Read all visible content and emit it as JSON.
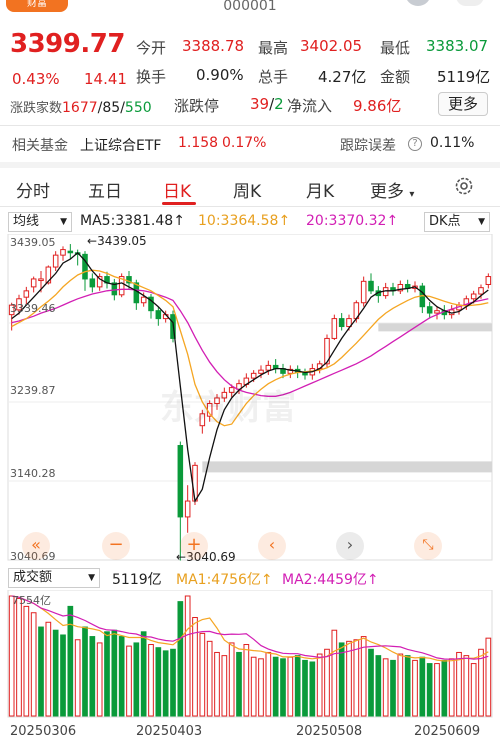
{
  "header": {
    "logo_text": "财富",
    "code": "000001"
  },
  "quote": {
    "price": "3399.77",
    "change_pct": "0.43%",
    "change": "14.41",
    "fields": [
      {
        "label": "今开",
        "value": "3388.78",
        "color": "red"
      },
      {
        "label": "最高",
        "value": "3402.05",
        "color": "red"
      },
      {
        "label": "最低",
        "value": "3383.07",
        "color": "green"
      },
      {
        "label": "换手",
        "value": "0.90%",
        "color": "black"
      },
      {
        "label": "总手",
        "value": "4.27亿",
        "color": "black"
      },
      {
        "label": "金额",
        "value": "5119亿",
        "color": "black"
      }
    ],
    "breadth_label": "涨跌家数",
    "breadth_up": "1677",
    "breadth_sep1": "/85/",
    "breadth_down": "550",
    "limit_label": "涨跌停",
    "limit_up": "39",
    "limit_sep": "/",
    "limit_down": "2",
    "inflow_label": "净流入",
    "inflow_value": "9.86亿",
    "more_label": "更多"
  },
  "fund_bar": {
    "label": "相关基金",
    "name": "上证综合ETF",
    "price": "1.158",
    "pct": "0.17%",
    "track_label": "跟踪误差",
    "track_value": "0.11%"
  },
  "tabs": [
    {
      "label": "分时"
    },
    {
      "label": "五日"
    },
    {
      "label": "日K",
      "active": true
    },
    {
      "label": "周K"
    },
    {
      "label": "月K"
    },
    {
      "label": "更多"
    }
  ],
  "ma_bar": {
    "select": "均线",
    "ma5": "MA5:3381.48",
    "ma10": "10:3364.58",
    "ma20": "20:3370.32",
    "dk": "DK点"
  },
  "price_axis": [
    "3439.05",
    "3339.46",
    "3239.87",
    "3140.28",
    "3040.69"
  ],
  "annotations": {
    "high": "3439.05",
    "low": "3040.69"
  },
  "watermark": "东方财富",
  "vol_bar": {
    "select": "成交额",
    "value": "5119亿",
    "ma1": "MA1:4756亿",
    "ma2": "MA2:4459亿",
    "axis_top": "7554亿"
  },
  "dates": [
    "20250306",
    "20250403",
    "20250508",
    "20250609"
  ],
  "colors": {
    "up": "#e02020",
    "down": "#0a9a3a",
    "ma5": "#111111",
    "ma10": "#f5a623",
    "ma20": "#d21fb4"
  },
  "chart_data": {
    "type": "candlestick",
    "ylim": [
      3040.69,
      3439.05
    ],
    "candles": [
      [
        3350,
        3362,
        3330,
        3365,
        "up"
      ],
      [
        3356,
        3370,
        3350,
        3375,
        "up"
      ],
      [
        3372,
        3380,
        3362,
        3385,
        "up"
      ],
      [
        3385,
        3395,
        3378,
        3398,
        "up"
      ],
      [
        3393,
        3395,
        3378,
        3405,
        "up"
      ],
      [
        3390,
        3410,
        3388,
        3412,
        "up"
      ],
      [
        3410,
        3425,
        3405,
        3430,
        "up"
      ],
      [
        3425,
        3432,
        3418,
        3436,
        "up"
      ],
      [
        3430,
        3428,
        3420,
        3439,
        "down"
      ],
      [
        3428,
        3426,
        3412,
        3432,
        "down"
      ],
      [
        3426,
        3395,
        3380,
        3430,
        "down"
      ],
      [
        3395,
        3385,
        3378,
        3402,
        "down"
      ],
      [
        3385,
        3398,
        3380,
        3402,
        "up"
      ],
      [
        3398,
        3390,
        3383,
        3404,
        "down"
      ],
      [
        3390,
        3375,
        3368,
        3395,
        "down"
      ],
      [
        3375,
        3398,
        3372,
        3402,
        "up"
      ],
      [
        3398,
        3390,
        3382,
        3405,
        "down"
      ],
      [
        3390,
        3365,
        3356,
        3394,
        "down"
      ],
      [
        3365,
        3372,
        3360,
        3378,
        "up"
      ],
      [
        3372,
        3355,
        3345,
        3376,
        "down"
      ],
      [
        3355,
        3345,
        3336,
        3360,
        "down"
      ],
      [
        3345,
        3350,
        3340,
        3355,
        "up"
      ],
      [
        3350,
        3320,
        3315,
        3355,
        "down"
      ],
      [
        3185,
        3095,
        3040,
        3190,
        "down"
      ],
      [
        3095,
        3115,
        3075,
        3135,
        "up"
      ],
      [
        3115,
        3160,
        3110,
        3164,
        "up"
      ],
      [
        3210,
        3225,
        3200,
        3230,
        "up"
      ],
      [
        3222,
        3238,
        3215,
        3242,
        "up"
      ],
      [
        3238,
        3245,
        3230,
        3250,
        "up"
      ],
      [
        3245,
        3252,
        3240,
        3258,
        "up"
      ],
      [
        3252,
        3258,
        3246,
        3262,
        "up"
      ],
      [
        3256,
        3263,
        3250,
        3268,
        "up"
      ],
      [
        3262,
        3270,
        3258,
        3276,
        "up"
      ],
      [
        3270,
        3276,
        3265,
        3280,
        "up"
      ],
      [
        3276,
        3280,
        3270,
        3286,
        "up"
      ],
      [
        3280,
        3286,
        3274,
        3292,
        "up"
      ],
      [
        3286,
        3282,
        3276,
        3294,
        "down"
      ],
      [
        3282,
        3276,
        3270,
        3288,
        "down"
      ],
      [
        3276,
        3281,
        3270,
        3286,
        "up"
      ],
      [
        3281,
        3277,
        3270,
        3286,
        "down"
      ],
      [
        3277,
        3274,
        3268,
        3282,
        "down"
      ],
      [
        3274,
        3282,
        3268,
        3288,
        "up"
      ],
      [
        3282,
        3288,
        3276,
        3292,
        "up"
      ],
      [
        3288,
        3320,
        3284,
        3325,
        "up"
      ],
      [
        3320,
        3345,
        3318,
        3350,
        "up"
      ],
      [
        3345,
        3335,
        3330,
        3352,
        "down"
      ],
      [
        3335,
        3345,
        3330,
        3350,
        "up"
      ],
      [
        3345,
        3365,
        3340,
        3368,
        "up"
      ],
      [
        3365,
        3392,
        3360,
        3398,
        "up"
      ],
      [
        3392,
        3380,
        3376,
        3402,
        "down"
      ],
      [
        3380,
        3374,
        3365,
        3386,
        "down"
      ],
      [
        3374,
        3384,
        3370,
        3390,
        "up"
      ],
      [
        3384,
        3380,
        3374,
        3390,
        "down"
      ],
      [
        3380,
        3388,
        3376,
        3393,
        "up"
      ],
      [
        3388,
        3383,
        3378,
        3394,
        "down"
      ],
      [
        3383,
        3386,
        3378,
        3392,
        "up"
      ],
      [
        3386,
        3360,
        3352,
        3390,
        "down"
      ],
      [
        3360,
        3352,
        3345,
        3366,
        "down"
      ],
      [
        3352,
        3355,
        3344,
        3360,
        "up"
      ],
      [
        3355,
        3350,
        3344,
        3362,
        "down"
      ],
      [
        3350,
        3356,
        3345,
        3362,
        "up"
      ],
      [
        3356,
        3362,
        3350,
        3366,
        "up"
      ],
      [
        3362,
        3370,
        3356,
        3374,
        "up"
      ],
      [
        3370,
        3376,
        3364,
        3380,
        "up"
      ],
      [
        3376,
        3384,
        3370,
        3388,
        "up"
      ],
      [
        3388,
        3398,
        3383,
        3402,
        "up"
      ]
    ],
    "ma5": [
      3345,
      3352,
      3362,
      3372,
      3382,
      3392,
      3402,
      3415,
      3420,
      3428,
      3418,
      3405,
      3395,
      3390,
      3388,
      3390,
      3385,
      3380,
      3374,
      3368,
      3360,
      3350,
      3340,
      3260,
      3180,
      3115,
      3130,
      3170,
      3205,
      3230,
      3245,
      3255,
      3262,
      3268,
      3274,
      3279,
      3282,
      3282,
      3280,
      3279,
      3277,
      3278,
      3282,
      3290,
      3305,
      3320,
      3333,
      3345,
      3358,
      3372,
      3378,
      3380,
      3380,
      3382,
      3383,
      3385,
      3378,
      3368,
      3360,
      3355,
      3352,
      3354,
      3360,
      3366,
      3374,
      3381
    ],
    "ma10": [
      3335,
      3340,
      3345,
      3352,
      3360,
      3367,
      3375,
      3385,
      3393,
      3400,
      3404,
      3406,
      3405,
      3402,
      3398,
      3395,
      3392,
      3388,
      3384,
      3380,
      3374,
      3368,
      3360,
      3330,
      3300,
      3262,
      3240,
      3225,
      3215,
      3210,
      3212,
      3225,
      3238,
      3248,
      3256,
      3263,
      3268,
      3272,
      3275,
      3277,
      3278,
      3279,
      3280,
      3283,
      3288,
      3296,
      3305,
      3314,
      3324,
      3334,
      3344,
      3352,
      3358,
      3363,
      3368,
      3372,
      3374,
      3373,
      3370,
      3367,
      3364,
      3362,
      3361,
      3362,
      3363,
      3365
    ],
    "ma20": [
      3340,
      3342,
      3345,
      3348,
      3352,
      3355,
      3358,
      3362,
      3366,
      3370,
      3373,
      3376,
      3378,
      3380,
      3381,
      3382,
      3382,
      3381,
      3380,
      3378,
      3375,
      3372,
      3368,
      3355,
      3340,
      3322,
      3305,
      3290,
      3278,
      3268,
      3260,
      3255,
      3252,
      3250,
      3248,
      3247,
      3247,
      3249,
      3252,
      3256,
      3260,
      3264,
      3268,
      3272,
      3276,
      3280,
      3284,
      3288,
      3293,
      3298,
      3304,
      3310,
      3316,
      3322,
      3328,
      3334,
      3340,
      3346,
      3350,
      3354,
      3357,
      3360,
      3363,
      3366,
      3368,
      3370
    ],
    "volume": [
      [
        7554,
        "up"
      ],
      [
        7400,
        "up"
      ],
      [
        6900,
        "up"
      ],
      [
        6500,
        "up"
      ],
      [
        5600,
        "down"
      ],
      [
        5900,
        "up"
      ],
      [
        5400,
        "down"
      ],
      [
        5100,
        "down"
      ],
      [
        6900,
        "down"
      ],
      [
        4800,
        "up"
      ],
      [
        5600,
        "down"
      ],
      [
        5000,
        "down"
      ],
      [
        4600,
        "up"
      ],
      [
        5300,
        "down"
      ],
      [
        5400,
        "down"
      ],
      [
        5000,
        "down"
      ],
      [
        4400,
        "up"
      ],
      [
        4600,
        "down"
      ],
      [
        5300,
        "down"
      ],
      [
        4500,
        "up"
      ],
      [
        4300,
        "down"
      ],
      [
        4100,
        "down"
      ],
      [
        4200,
        "down"
      ],
      [
        7200,
        "down"
      ],
      [
        7554,
        "up"
      ],
      [
        6200,
        "up"
      ],
      [
        5200,
        "up"
      ],
      [
        4700,
        "up"
      ],
      [
        4000,
        "up"
      ],
      [
        3800,
        "up"
      ],
      [
        4600,
        "up"
      ],
      [
        4000,
        "down"
      ],
      [
        4500,
        "up"
      ],
      [
        3700,
        "up"
      ],
      [
        3600,
        "up"
      ],
      [
        4000,
        "up"
      ],
      [
        3700,
        "down"
      ],
      [
        3600,
        "down"
      ],
      [
        3700,
        "up"
      ],
      [
        3800,
        "down"
      ],
      [
        3500,
        "down"
      ],
      [
        3400,
        "down"
      ],
      [
        3900,
        "up"
      ],
      [
        4200,
        "up"
      ],
      [
        5400,
        "up"
      ],
      [
        4600,
        "down"
      ],
      [
        4700,
        "up"
      ],
      [
        4800,
        "up"
      ],
      [
        5000,
        "up"
      ],
      [
        4200,
        "down"
      ],
      [
        3800,
        "down"
      ],
      [
        3600,
        "up"
      ],
      [
        3500,
        "down"
      ],
      [
        3900,
        "up"
      ],
      [
        3800,
        "down"
      ],
      [
        3500,
        "up"
      ],
      [
        3700,
        "down"
      ],
      [
        3300,
        "down"
      ],
      [
        3300,
        "up"
      ],
      [
        3500,
        "down"
      ],
      [
        3600,
        "up"
      ],
      [
        4000,
        "up"
      ],
      [
        3800,
        "up"
      ],
      [
        3300,
        "up"
      ],
      [
        4200,
        "up"
      ],
      [
        4900,
        "up"
      ]
    ],
    "vol_ylim": [
      0,
      7554
    ]
  }
}
